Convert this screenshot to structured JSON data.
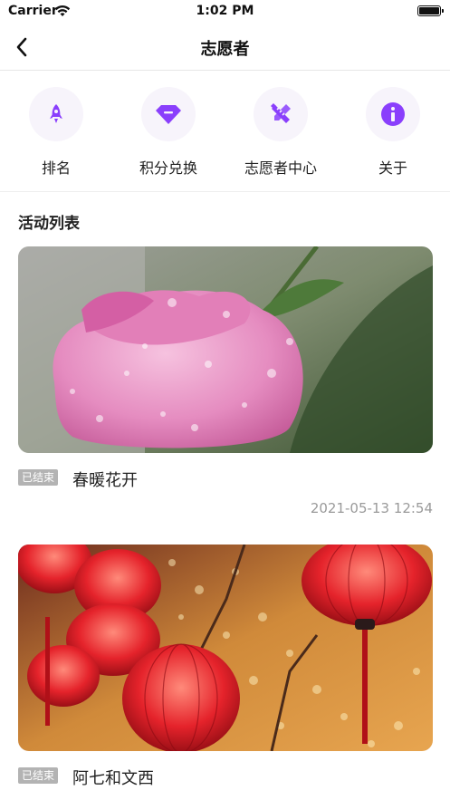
{
  "status_bar": {
    "carrier": "Carrier",
    "time": "1:02 PM"
  },
  "nav": {
    "title": "志愿者"
  },
  "quick_menu": [
    {
      "label": "排名",
      "icon": "rocket-icon"
    },
    {
      "label": "积分兑换",
      "icon": "gem-icon"
    },
    {
      "label": "志愿者中心",
      "icon": "tools-icon"
    },
    {
      "label": "关于",
      "icon": "info-icon"
    }
  ],
  "colors": {
    "accent": "#8a3ffc",
    "icon_bg": "#f7f4fb",
    "badge": "#b3b3b3",
    "date": "#9a9a9a"
  },
  "section": {
    "title": "活动列表"
  },
  "activities": [
    {
      "status": "已结束",
      "title": "春暖花开",
      "date": "2021-05-13 12:54"
    },
    {
      "status": "已结束",
      "title": "阿七和文西",
      "date": ""
    }
  ]
}
